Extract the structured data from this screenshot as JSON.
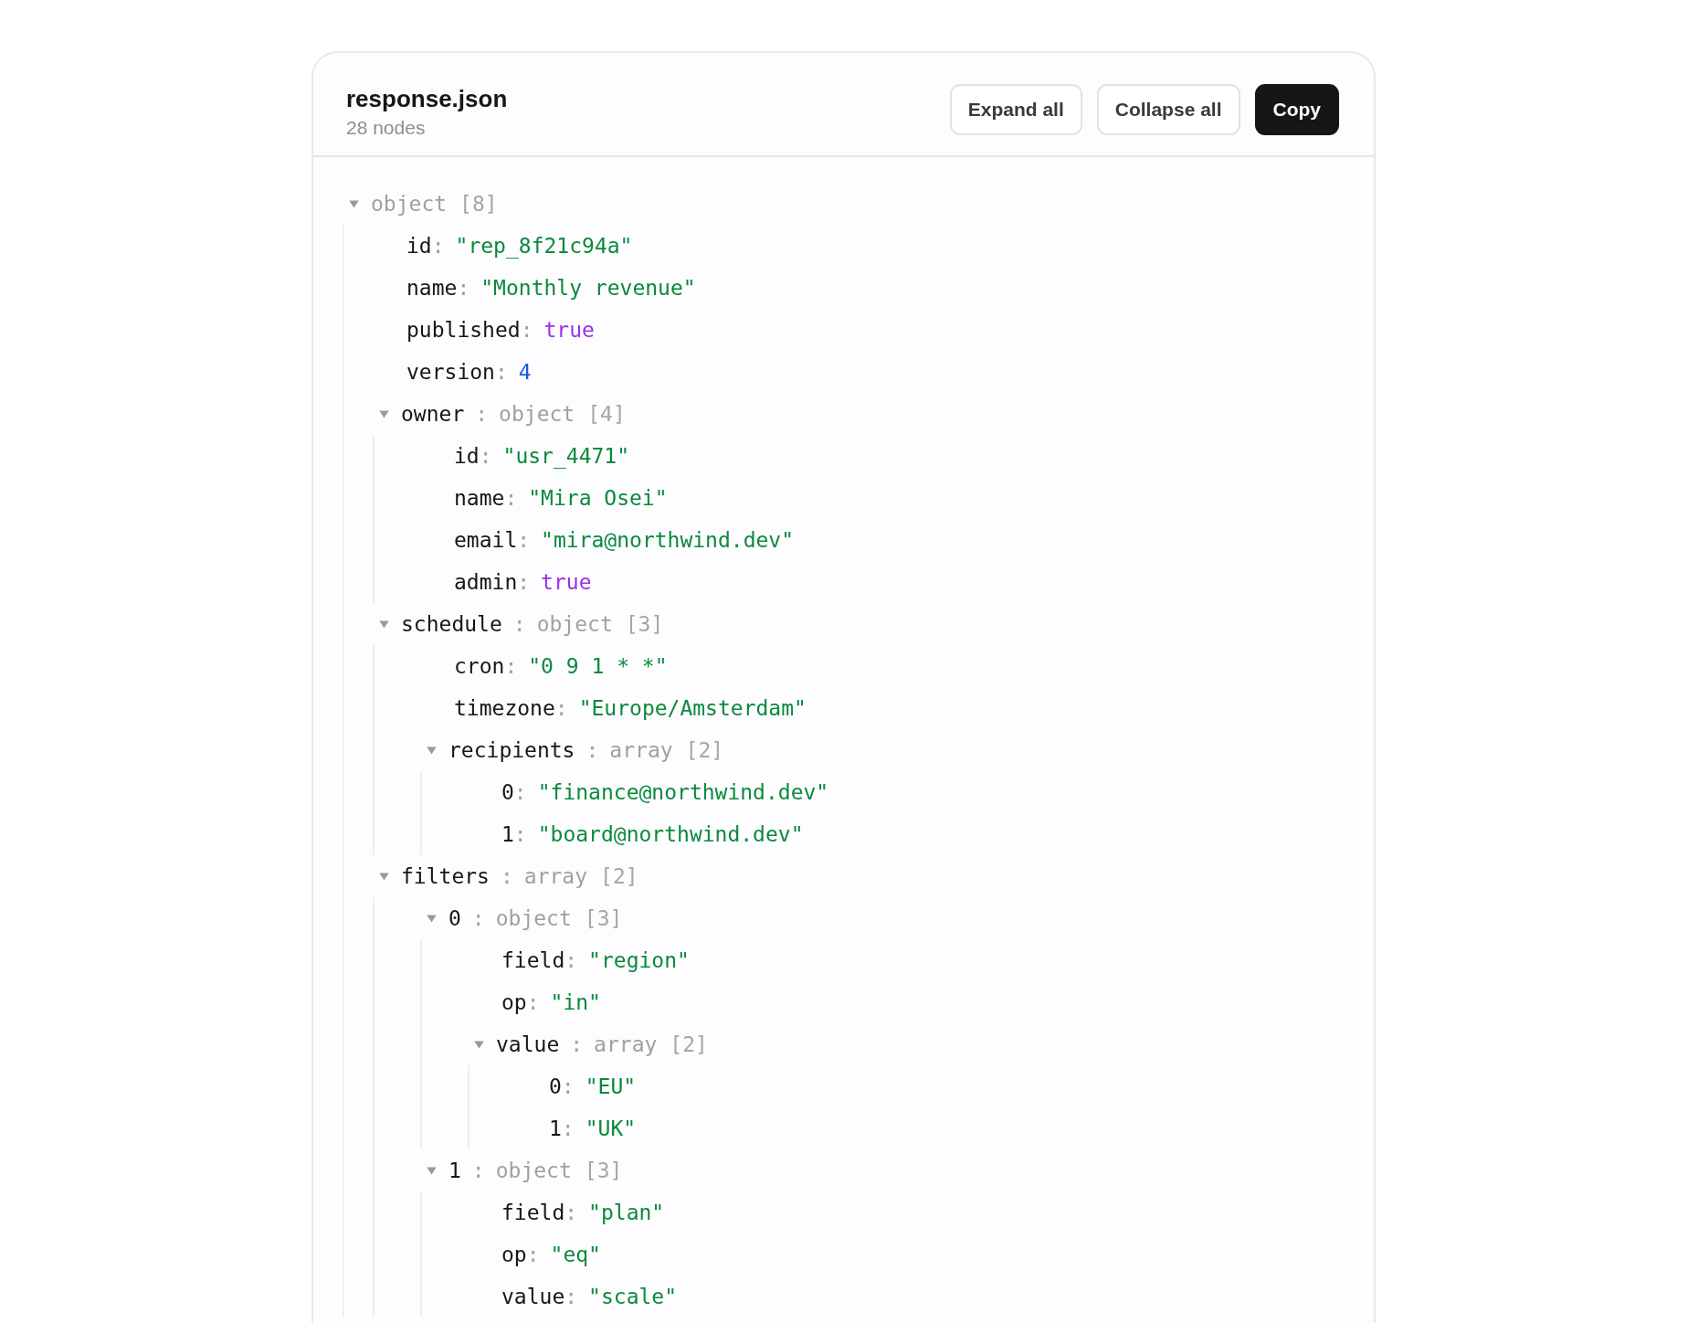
{
  "header": {
    "title": "response.json",
    "subtitle": "28 nodes",
    "buttons": [
      {
        "label": "Expand all",
        "kind": "outline"
      },
      {
        "label": "Collapse all",
        "kind": "outline"
      },
      {
        "label": "Copy",
        "kind": "solid"
      }
    ]
  },
  "tree": {
    "kind": "branch",
    "type": "object",
    "count": "[8]",
    "expanded": true,
    "children": [
      {
        "kind": "string",
        "key": "id",
        "colon": ":",
        "value": "\"rep_8f21c94a\""
      },
      {
        "kind": "string",
        "key": "name",
        "colon": ":",
        "value": "\"Monthly revenue\""
      },
      {
        "kind": "boolean",
        "key": "published",
        "colon": ":",
        "value": "true"
      },
      {
        "kind": "number",
        "key": "version",
        "colon": ":",
        "value": "4"
      },
      {
        "kind": "branch",
        "key": "owner",
        "colon": ":",
        "type": "object",
        "count": "[4]",
        "expanded": true,
        "children": [
          {
            "kind": "string",
            "key": "id",
            "colon": ":",
            "value": "\"usr_4471\""
          },
          {
            "kind": "string",
            "key": "name",
            "colon": ":",
            "value": "\"Mira Osei\""
          },
          {
            "kind": "string",
            "key": "email",
            "colon": ":",
            "value": "\"mira@northwind.dev\""
          },
          {
            "kind": "boolean",
            "key": "admin",
            "colon": ":",
            "value": "true"
          }
        ]
      },
      {
        "kind": "branch",
        "key": "schedule",
        "colon": ":",
        "type": "object",
        "count": "[3]",
        "expanded": true,
        "children": [
          {
            "kind": "string",
            "key": "cron",
            "colon": ":",
            "value": "\"0 9 1 * *\""
          },
          {
            "kind": "string",
            "key": "timezone",
            "colon": ":",
            "value": "\"Europe/Amsterdam\""
          },
          {
            "kind": "branch",
            "key": "recipients",
            "colon": ":",
            "type": "array",
            "count": "[2]",
            "expanded": true,
            "children": [
              {
                "kind": "string",
                "key": "0",
                "colon": ":",
                "value": "\"finance@northwind.dev\""
              },
              {
                "kind": "string",
                "key": "1",
                "colon": ":",
                "value": "\"board@northwind.dev\""
              }
            ]
          }
        ]
      },
      {
        "kind": "branch",
        "key": "filters",
        "colon": ":",
        "type": "array",
        "count": "[2]",
        "expanded": true,
        "children": [
          {
            "kind": "branch",
            "key": "0",
            "colon": ":",
            "type": "object",
            "count": "[3]",
            "expanded": true,
            "children": [
              {
                "kind": "string",
                "key": "field",
                "colon": ":",
                "value": "\"region\""
              },
              {
                "kind": "string",
                "key": "op",
                "colon": ":",
                "value": "\"in\""
              },
              {
                "kind": "branch",
                "key": "value",
                "colon": ":",
                "type": "array",
                "count": "[2]",
                "expanded": true,
                "children": [
                  {
                    "kind": "string",
                    "key": "0",
                    "colon": ":",
                    "value": "\"EU\""
                  },
                  {
                    "kind": "string",
                    "key": "1",
                    "colon": ":",
                    "value": "\"UK\""
                  }
                ]
              }
            ]
          },
          {
            "kind": "branch",
            "key": "1",
            "colon": ":",
            "type": "object",
            "count": "[3]",
            "expanded": true,
            "children": [
              {
                "kind": "string",
                "key": "field",
                "colon": ":",
                "value": "\"plan\""
              },
              {
                "kind": "string",
                "key": "op",
                "colon": ":",
                "value": "\"eq\""
              },
              {
                "kind": "string",
                "key": "value",
                "colon": ":",
                "value": "\"scale\""
              }
            ]
          }
        ]
      }
    ]
  }
}
